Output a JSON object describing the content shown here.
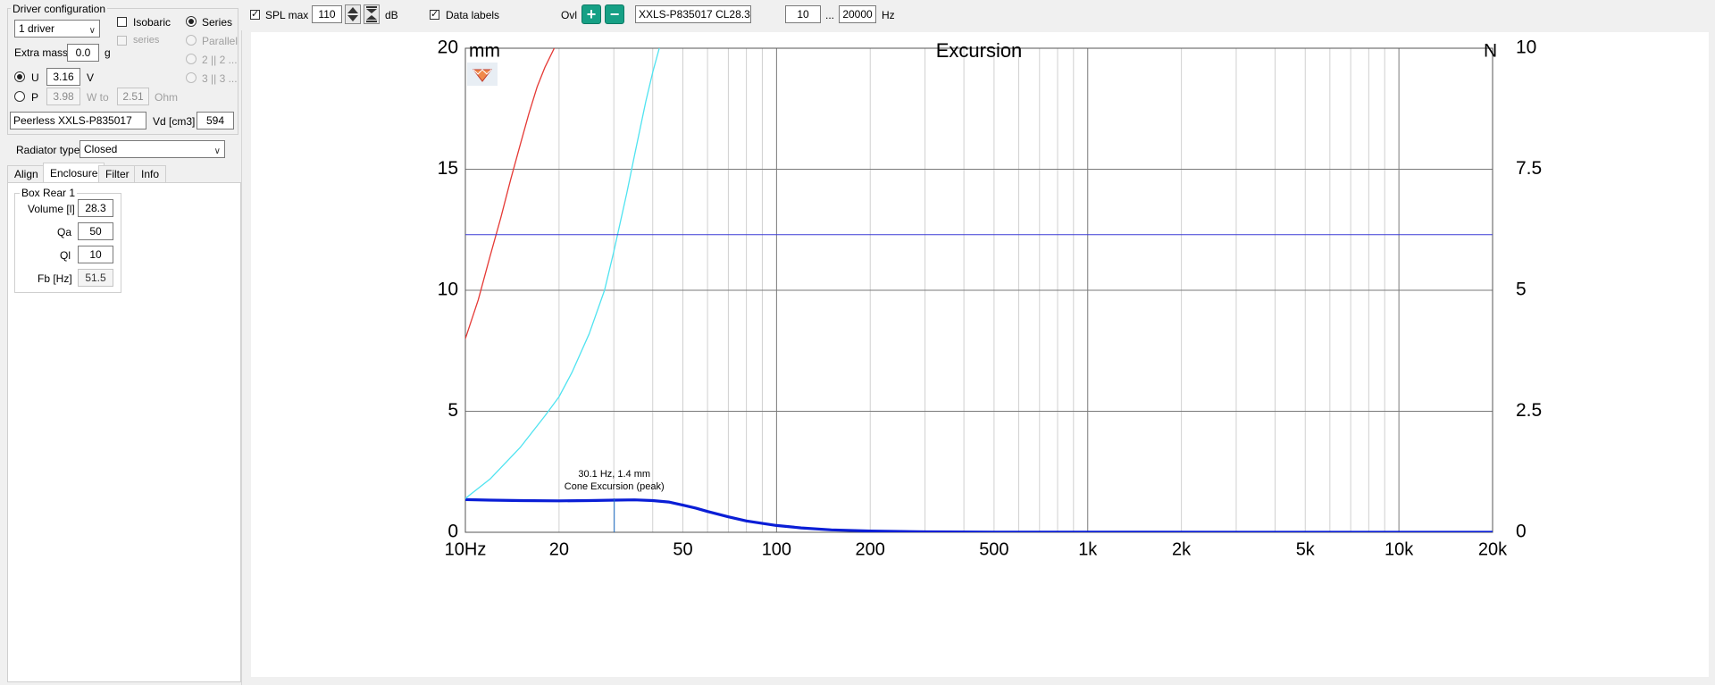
{
  "driver_config": {
    "group_title": "Driver configuration",
    "driver_count": "1 driver",
    "isobaric_label": "Isobaric",
    "series_sub_label": "series",
    "series_label": "Series",
    "parallel_label": "Parallel",
    "option_2": "2 || 2 ...",
    "option_3": "3 || 3 ...",
    "extra_mass_label": "Extra mass",
    "extra_mass_value": "0.0",
    "extra_mass_unit": "g",
    "u_label": "U",
    "u_value": "3.16",
    "u_unit": "V",
    "p_label": "P",
    "p_value": "3.98",
    "p_unit": "W to",
    "ohm_value": "2.51",
    "ohm_unit": "Ohm",
    "driver_name": "Peerless XXLS-P835017",
    "vd_label": "Vd [cm3]",
    "vd_value": "594"
  },
  "radiator": {
    "label": "Radiator type",
    "value": "Closed"
  },
  "tabs": [
    {
      "label": "Align"
    },
    {
      "label": "Enclosure"
    },
    {
      "label": "Filter"
    },
    {
      "label": "Info"
    }
  ],
  "box": {
    "title": "Box Rear 1",
    "volume_label": "Volume [l]",
    "volume_value": "28.3",
    "qa_label": "Qa",
    "qa_value": "50",
    "ql_label": "Ql",
    "ql_value": "10",
    "fb_label": "Fb [Hz]",
    "fb_value": "51.5"
  },
  "toolbar": {
    "spl_max_label": "SPL max",
    "spl_max_value": "110",
    "db_unit": "dB",
    "data_labels_label": "Data labels",
    "ovl_label": "Ovl",
    "overlay_name": "XXLS-P835017 CL28.3",
    "freq_min": "10",
    "range_sep": "...",
    "freq_max": "20000",
    "hz_unit": "Hz"
  },
  "colors": {
    "excursion": "#0a1ed6",
    "red_curve": "#e53935",
    "cyan_curve": "#4fe3f0",
    "hline": "#3a3ad6",
    "grid_major": "#7a7a7a",
    "grid_minor": "#d0d0d0",
    "accent_button": "#16a085"
  },
  "chart_data": {
    "type": "line",
    "title": "Excursion",
    "ylabel": "mm",
    "y2label": "N",
    "x_scale": "log",
    "xlim": [
      10,
      20000
    ],
    "ylim": [
      0,
      20
    ],
    "y2lim": [
      0,
      10
    ],
    "x_ticks": [
      {
        "v": 10,
        "label": "10Hz"
      },
      {
        "v": 20,
        "label": "20"
      },
      {
        "v": 50,
        "label": "50"
      },
      {
        "v": 100,
        "label": "100"
      },
      {
        "v": 200,
        "label": "200"
      },
      {
        "v": 500,
        "label": "500"
      },
      {
        "v": 1000,
        "label": "1k"
      },
      {
        "v": 2000,
        "label": "2k"
      },
      {
        "v": 5000,
        "label": "5k"
      },
      {
        "v": 10000,
        "label": "10k"
      },
      {
        "v": 20000,
        "label": "20k"
      }
    ],
    "y_ticks": [
      {
        "v": 0,
        "label": "0"
      },
      {
        "v": 5,
        "label": "5"
      },
      {
        "v": 10,
        "label": "10"
      },
      {
        "v": 15,
        "label": "15"
      },
      {
        "v": 20,
        "label": "20"
      }
    ],
    "y2_ticks": [
      {
        "v": 0,
        "label": "0"
      },
      {
        "v": 2.5,
        "label": "2.5"
      },
      {
        "v": 5,
        "label": "5"
      },
      {
        "v": 7.5,
        "label": "7.5"
      },
      {
        "v": 10,
        "label": "10"
      }
    ],
    "series": [
      {
        "style": "excursion",
        "x": [
          10,
          12,
          15,
          20,
          25,
          30.1,
          35,
          40,
          45,
          50,
          55,
          60,
          70,
          80,
          100,
          120,
          150,
          200,
          300,
          500,
          1000,
          20000
        ],
        "y": [
          1.35,
          1.33,
          1.31,
          1.3,
          1.31,
          1.33,
          1.34,
          1.31,
          1.25,
          1.12,
          1.0,
          0.86,
          0.64,
          0.47,
          0.28,
          0.18,
          0.1,
          0.05,
          0.02,
          0.008,
          0.002,
          0.0
        ]
      },
      {
        "style": "red",
        "x": [
          10,
          11,
          12,
          13,
          14,
          15,
          16,
          17,
          18,
          19.3
        ],
        "y": [
          8.0,
          9.6,
          11.4,
          13.0,
          14.6,
          16.0,
          17.3,
          18.4,
          19.2,
          20.0
        ]
      },
      {
        "style": "cyan",
        "x": [
          10,
          12,
          15,
          18,
          20,
          22,
          25,
          28,
          30,
          33,
          35,
          38,
          40,
          42
        ],
        "y": [
          1.4,
          2.2,
          3.5,
          4.8,
          5.6,
          6.6,
          8.2,
          10.0,
          11.6,
          14.0,
          15.6,
          17.8,
          19.0,
          20.0
        ]
      },
      {
        "style": "hline",
        "x": [
          10,
          20000
        ],
        "y": [
          12.3,
          12.3
        ]
      }
    ],
    "marker": {
      "x": 30.1,
      "y": 1.4,
      "text_1": "30.1 Hz, 1.4 mm",
      "text_2": "Cone Excursion (peak)"
    }
  }
}
